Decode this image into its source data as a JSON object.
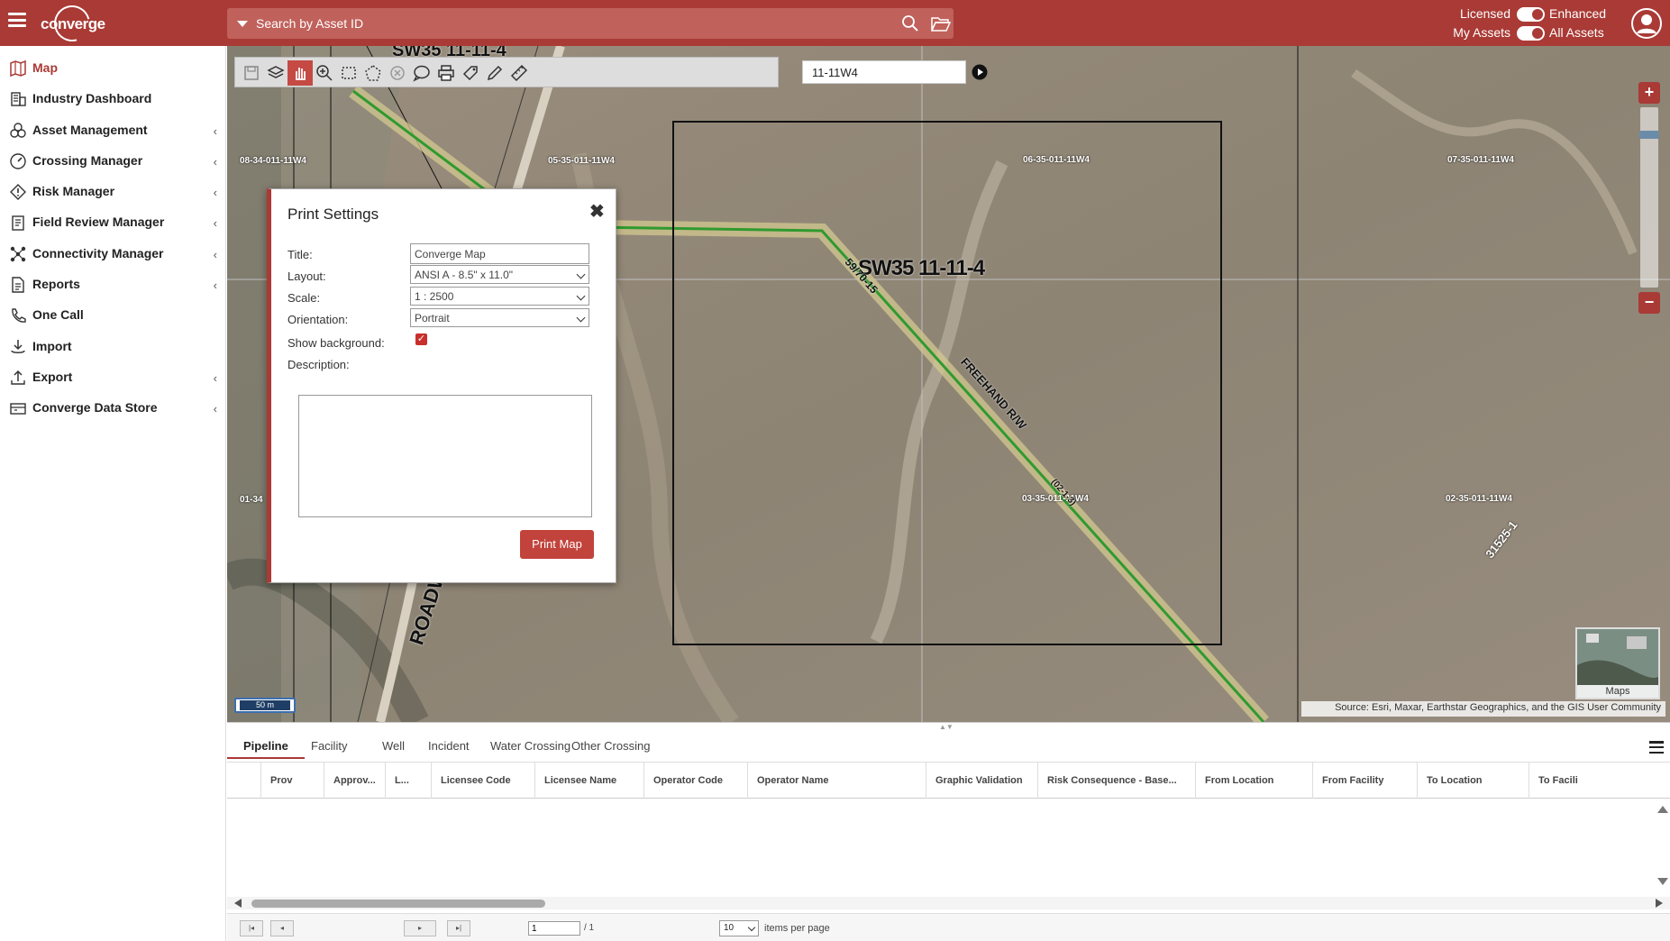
{
  "header": {
    "logo_text": "converge",
    "search_placeholder": "Search by Asset ID",
    "toggle1": {
      "label": "Licensed",
      "value": "Enhanced"
    },
    "toggle2": {
      "label": "My Assets",
      "value": "All Assets"
    }
  },
  "sidebar": {
    "items": [
      {
        "label": "Map",
        "icon": "map-icon",
        "active": true,
        "expandable": false
      },
      {
        "label": "Industry Dashboard",
        "icon": "building-icon",
        "expandable": false
      },
      {
        "label": "Asset Management",
        "icon": "assets-icon",
        "expandable": true
      },
      {
        "label": "Crossing Manager",
        "icon": "gauge-icon",
        "expandable": true
      },
      {
        "label": "Risk Manager",
        "icon": "warning-icon",
        "expandable": true
      },
      {
        "label": "Field Review Manager",
        "icon": "clipboard-icon",
        "expandable": true
      },
      {
        "label": "Connectivity Manager",
        "icon": "network-icon",
        "expandable": true
      },
      {
        "label": "Reports",
        "icon": "document-icon",
        "expandable": true
      },
      {
        "label": "One Call",
        "icon": "phone-icon",
        "expandable": false
      },
      {
        "label": "Import",
        "icon": "import-icon",
        "expandable": false
      },
      {
        "label": "Export",
        "icon": "export-icon",
        "expandable": true
      },
      {
        "label": "Converge Data Store",
        "icon": "datastore-icon",
        "expandable": true
      }
    ],
    "chevron": "‹"
  },
  "map": {
    "coordinate_input": "11-11W4",
    "scale_label": "50 m",
    "basemap_label": "Maps",
    "source_text": "Source: Esri, Maxar, Earthstar Geographics, and the GIS User Community",
    "zoom_in": "+",
    "zoom_out": "−",
    "labels": {
      "sw35_top": "SW35 11-11-4",
      "sw35_main": "SW35 11-11-4",
      "lsd_0834": "08-34-011-11W4",
      "lsd_0535": "05-35-011-11W4",
      "lsd_0635": "06-35-011-11W4",
      "lsd_0735": "07-35-011-11W4",
      "lsd_0134": "01-34",
      "lsd_0335": "03-35-011-11W4",
      "lsd_0235": "02-35-011-11W4",
      "road": "ROADW",
      "pipe1": "59/70-15",
      "pipe2": "FREEHAND R/W",
      "pipe3": "(02-1-3)",
      "pipe4": "31525-1"
    },
    "tools": [
      "save-icon",
      "layers-icon",
      "pan-icon",
      "zoom-in-icon",
      "rectangle-select-icon",
      "polygon-select-icon",
      "clear-selection-icon",
      "comment-icon",
      "print-icon",
      "tag-icon",
      "pencil-icon",
      "ruler-icon"
    ]
  },
  "print_dialog": {
    "title": "Print Settings",
    "close": "✖",
    "title_label": "Title:",
    "title_value": "Converge Map",
    "layout_label": "Layout:",
    "layout_value": "ANSI A - 8.5\" x 11.0\"",
    "scale_label": "Scale:",
    "scale_value": "1 : 2500",
    "orientation_label": "Orientation:",
    "orientation_value": "Portrait",
    "background_label": "Show background:",
    "show_background": true,
    "description_label": "Description:",
    "description_value": "",
    "print_button": "Print Map"
  },
  "bottom": {
    "tabs": [
      "Pipeline",
      "Facility",
      "Well",
      "Incident",
      "Water Crossing",
      "Other Crossing"
    ],
    "active_tab": "Pipeline",
    "columns": [
      "Prov",
      "Approv...",
      "L...",
      "Licensee Code",
      "Licensee Name",
      "Operator Code",
      "Operator Name",
      "Graphic Validation",
      "Risk Consequence - Base...",
      "From Location",
      "From Facility",
      "To Location",
      "To Facili"
    ],
    "pager": {
      "page": "1",
      "of": "/ 1",
      "page_size": "10",
      "per_page_label": "items per page",
      "first": "|◂",
      "prev": "◂",
      "next": "▸",
      "last": "▸|"
    }
  },
  "colors": {
    "brand": "#a93a35",
    "pipeline": "#3aa83a"
  }
}
